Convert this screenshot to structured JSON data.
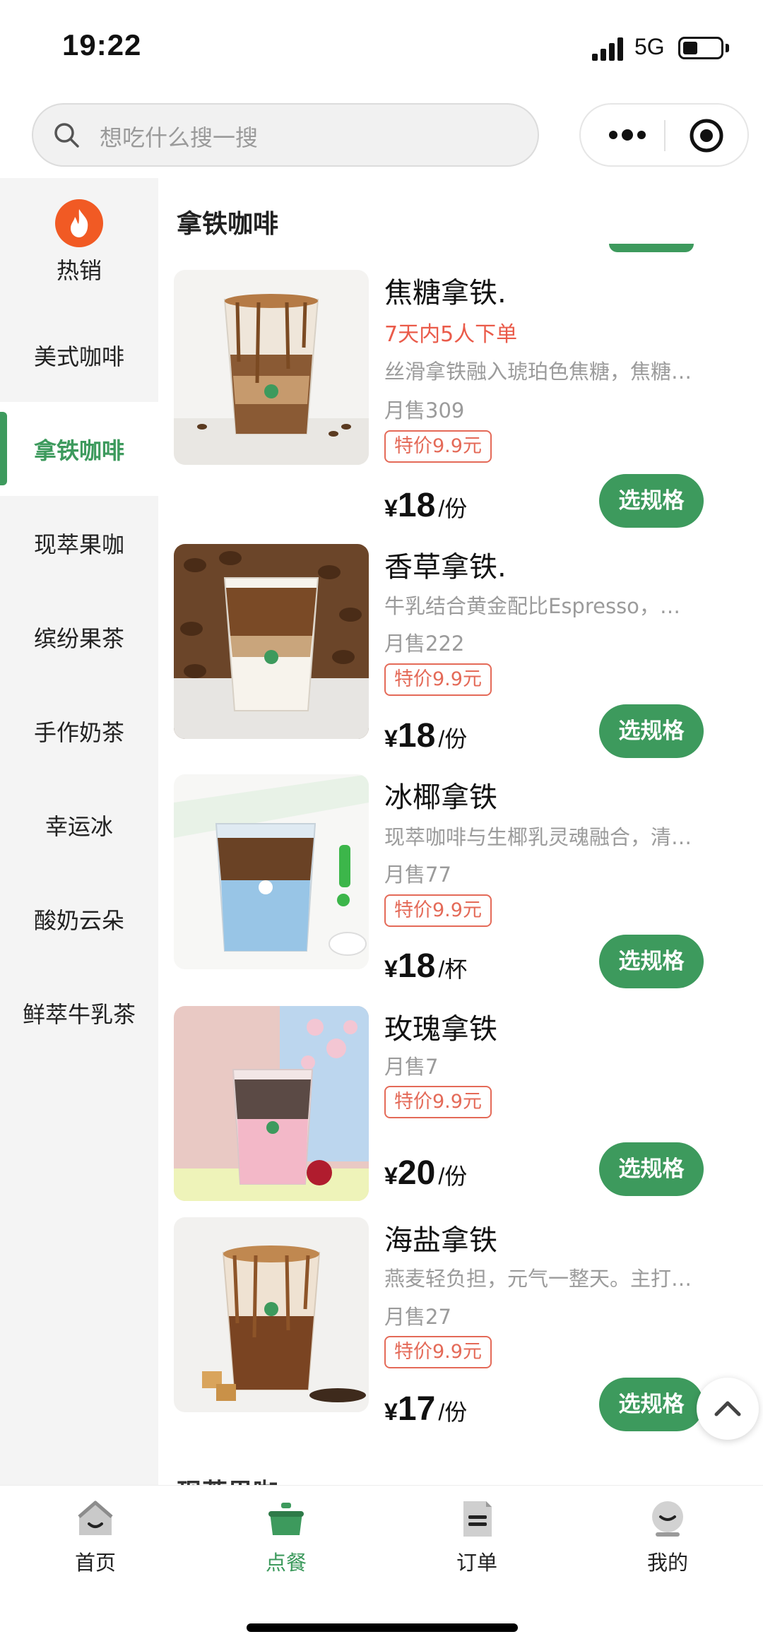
{
  "status_bar": {
    "time": "19:22",
    "network": "5G"
  },
  "search": {
    "placeholder": "想吃什么搜一搜"
  },
  "colors": {
    "brand_green": "#3d9a5d",
    "promo_red": "#e46a58",
    "hot_orange": "#f15a24"
  },
  "sidebar": {
    "hot_label": "热销",
    "items": [
      {
        "label": "美式咖啡",
        "active": false
      },
      {
        "label": "拿铁咖啡",
        "active": true
      },
      {
        "label": "现萃果咖",
        "active": false
      },
      {
        "label": "缤纷果茶",
        "active": false
      },
      {
        "label": "手作奶茶",
        "active": false
      },
      {
        "label": "幸运冰",
        "active": false
      },
      {
        "label": "酸奶云朵",
        "active": false
      },
      {
        "label": "鲜萃牛乳茶",
        "active": false
      }
    ]
  },
  "main": {
    "category_title": "拿铁咖啡",
    "next_category": "现萃果咖",
    "spec_button_label": "选规格",
    "products": [
      {
        "name": "焦糖拿铁.",
        "extra": "7天内5人下单",
        "desc": "丝滑拿铁融入琥珀色焦糖，焦糖风味浓郁",
        "sales": "月售309",
        "promo": "特价9.9元",
        "currency": "¥",
        "price": "18",
        "unit": "/份",
        "image_icon": "caramel-latte-cup"
      },
      {
        "name": "香草拿铁.",
        "extra": "",
        "desc": "牛乳结合黄金配比Espresso，香草风味",
        "sales": "月售222",
        "promo": "特价9.9元",
        "currency": "¥",
        "price": "18",
        "unit": "/份",
        "image_icon": "vanilla-latte-cup"
      },
      {
        "name": "冰椰拿铁",
        "extra": "",
        "desc": "现萃咖啡与生椰乳灵魂融合，清爽顺滑",
        "sales": "月售77",
        "promo": "特价9.9元",
        "currency": "¥",
        "price": "18",
        "unit": "/杯",
        "image_icon": "coconut-latte-cup"
      },
      {
        "name": "玫瑰拿铁",
        "extra": "",
        "desc": "",
        "sales": "月售7",
        "promo": "特价9.9元",
        "currency": "¥",
        "price": "20",
        "unit": "/份",
        "image_icon": "rose-latte-cup"
      },
      {
        "name": "海盐拿铁",
        "extra": "",
        "desc": "燕麦轻负担，元气一整天。主打清爽口感",
        "sales": "月售27",
        "promo": "特价9.9元",
        "currency": "¥",
        "price": "17",
        "unit": "/份",
        "image_icon": "sea-salt-latte-cup"
      }
    ]
  },
  "tab_bar": {
    "tabs": [
      {
        "label": "首页",
        "icon": "home-icon",
        "active": false
      },
      {
        "label": "点餐",
        "icon": "order-pot-icon",
        "active": true
      },
      {
        "label": "订单",
        "icon": "receipt-icon",
        "active": false
      },
      {
        "label": "我的",
        "icon": "profile-icon",
        "active": false
      }
    ]
  }
}
